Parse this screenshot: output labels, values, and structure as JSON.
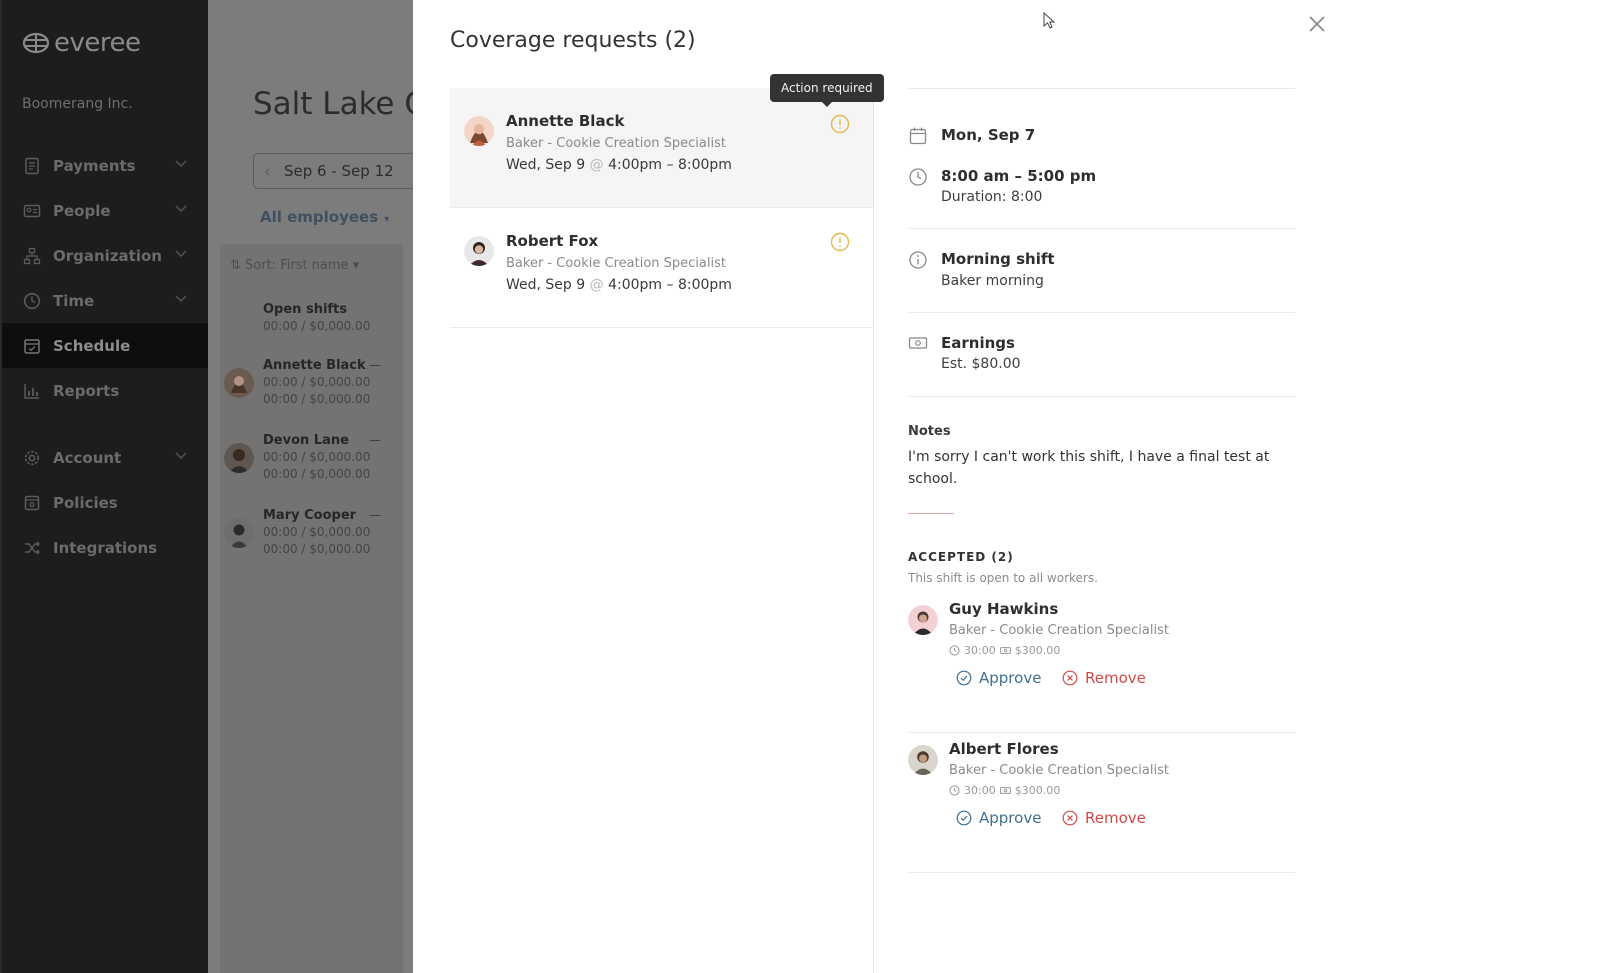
{
  "sidebar": {
    "logo_text": "everee",
    "company": "Boomerang Inc.",
    "items": [
      {
        "label": "Payments",
        "icon": "document-icon",
        "has_chevron": true
      },
      {
        "label": "People",
        "icon": "id-card-icon",
        "has_chevron": true
      },
      {
        "label": "Organization",
        "icon": "org-chart-icon",
        "has_chevron": true
      },
      {
        "label": "Time",
        "icon": "clock-icon",
        "has_chevron": true
      },
      {
        "label": "Schedule",
        "icon": "calendar-icon",
        "has_chevron": false,
        "active": true
      },
      {
        "label": "Reports",
        "icon": "bar-chart-icon",
        "has_chevron": false
      },
      {
        "label": "Account",
        "icon": "gear-icon",
        "has_chevron": true
      },
      {
        "label": "Policies",
        "icon": "policy-icon",
        "has_chevron": false
      },
      {
        "label": "Integrations",
        "icon": "shuffle-icon",
        "has_chevron": false
      }
    ]
  },
  "schedule": {
    "location_title": "Salt Lake C",
    "date_range": "Sep 6 - Sep 12",
    "filter": "All employees",
    "sort": "Sort: First name",
    "rows": [
      {
        "name": "Open shifts",
        "line1": "00:00 / $0,000.00",
        "line2": ""
      },
      {
        "name": "Annette Black",
        "line1": "00:00 / $0,000.00",
        "line2": "00:00 / $0,000.00"
      },
      {
        "name": "Devon Lane",
        "line1": "00:00 / $0,000.00",
        "line2": "00:00 / $0,000.00"
      },
      {
        "name": "Mary Cooper",
        "line1": "00:00 / $0,000.00",
        "line2": "00:00 / $0,000.00"
      }
    ],
    "row_dash": "—"
  },
  "modal": {
    "title": "Coverage requests (2)",
    "tooltip": "Action required",
    "requests": [
      {
        "name": "Annette Black",
        "role": "Baker - Cookie Creation Specialist",
        "day": "Wed, Sep 9",
        "at": "@",
        "time": "4:00pm – 8:00pm",
        "selected": true
      },
      {
        "name": "Robert Fox",
        "role": "Baker - Cookie Creation Specialist",
        "day": "Wed, Sep 9",
        "at": "@",
        "time": "4:00pm – 8:00pm",
        "selected": false
      }
    ],
    "detail": {
      "date": "Mon, Sep 7",
      "time_range": "8:00 am – 5:00 pm",
      "duration": "Duration: 8:00",
      "shift_name": "Morning shift",
      "shift_role": "Baker morning",
      "earnings_label": "Earnings",
      "earnings_value": "Est. $80.00",
      "notes_label": "Notes",
      "notes_text": "I'm sorry I can't work this shift, I have a final test at school.",
      "accepted_label": "ACCEPTED (2)",
      "accepted_sub": "This shift is open to all workers.",
      "workers": [
        {
          "name": "Guy Hawkins",
          "role": "Baker - Cookie Creation Specialist",
          "hours": "30:00",
          "pay": "$300.00"
        },
        {
          "name": "Albert Flores",
          "role": "Baker - Cookie Creation Specialist",
          "hours": "30:00",
          "pay": "$300.00"
        }
      ],
      "approve_label": "Approve",
      "remove_label": "Remove"
    }
  },
  "colors": {
    "sidebar_bg": "#1d1d1d",
    "overlay": "#7c7c7c",
    "warning": "#e8b84a",
    "approve": "#3f6f91",
    "remove": "#d14a4a"
  }
}
